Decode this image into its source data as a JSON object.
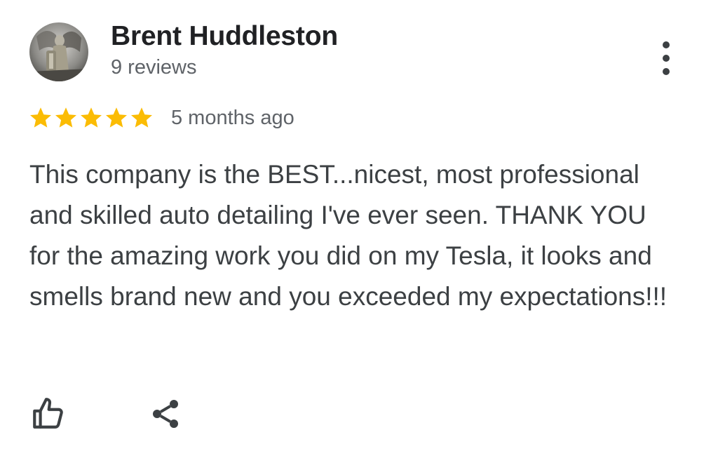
{
  "review": {
    "reviewer_name": "Brent Huddleston",
    "review_count": "9 reviews",
    "rating": 5,
    "rating_max": 5,
    "timestamp": "5 months ago",
    "text": "This company is the BEST...nicest, most professional and skilled auto detailing I've ever seen. THANK YOU for the amazing work you did on my Tesla, it looks and smells brand new and you exceeded my expectations!!!"
  },
  "icons": {
    "more": "more-vert-icon",
    "like": "thumb-up-icon",
    "share": "share-icon",
    "star": "star-icon"
  },
  "colors": {
    "star": "#fbbc04",
    "text": "#3c4043",
    "secondary": "#5f6368"
  }
}
